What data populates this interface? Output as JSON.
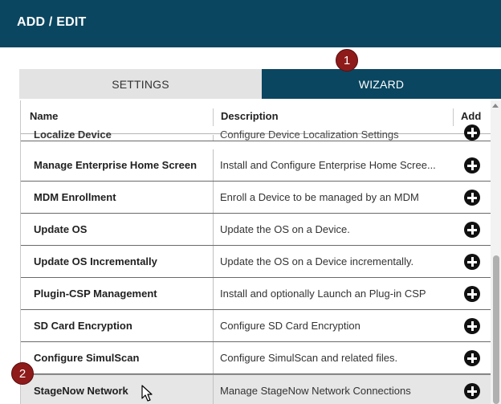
{
  "header": {
    "title": "ADD / EDIT"
  },
  "tabs": {
    "settings": "SETTINGS",
    "wizard": "WIZARD"
  },
  "callouts": {
    "first": "1",
    "second": "2"
  },
  "table": {
    "columns": {
      "name": "Name",
      "description": "Description",
      "add": "Add"
    },
    "rows": [
      {
        "name": "Localize Device",
        "description": "Configure Device Localization Settings"
      },
      {
        "name": "Manage Enterprise Home Screen",
        "description": "Install and Configure Enterprise Home Scree..."
      },
      {
        "name": "MDM Enrollment",
        "description": "Enroll a Device to be managed by an MDM"
      },
      {
        "name": "Update OS",
        "description": "Update the OS on a Device."
      },
      {
        "name": "Update OS Incrementally",
        "description": "Update the OS on a Device incrementally."
      },
      {
        "name": "Plugin-CSP Management",
        "description": "Install and optionally Launch an Plug-in CSP"
      },
      {
        "name": "SD Card Encryption",
        "description": "Configure SD Card Encryption"
      },
      {
        "name": "Configure SimulScan",
        "description": "Configure SimulScan and related files."
      },
      {
        "name": "StageNow Network",
        "description": "Manage StageNow Network Connections"
      }
    ]
  },
  "icons": {
    "add": "plus-circle-icon",
    "cursor": "mouse-pointer-icon"
  },
  "colors": {
    "header_bg": "#0a4660",
    "callout": "#8e1a1a",
    "tab_inactive": "#e3e3e3"
  }
}
